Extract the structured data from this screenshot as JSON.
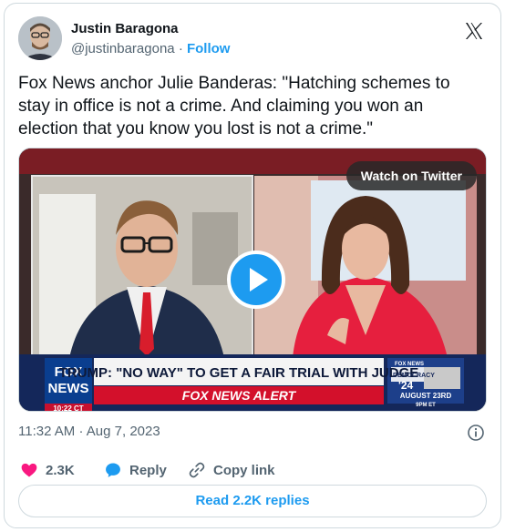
{
  "author": {
    "name": "Justin Baragona",
    "handle": "@justinbaragona",
    "separator": "·",
    "follow_label": "Follow"
  },
  "tweet": {
    "text": "Fox News anchor Julie Banderas: \"Hatching schemes to stay in office is not a crime. And claiming you won an election that you know you lost is not a crime.\"",
    "time": "11:32 AM",
    "date": "Aug 7, 2023",
    "meta_separator": "·"
  },
  "video": {
    "watch_label": "Watch on Twitter",
    "chyron_headline": "TRUMP: \"NO WAY\" TO GET A FAIR TRIAL WITH JUDGE",
    "chyron_alert": "FOX NEWS ALERT",
    "logo_line1": "FOX",
    "logo_line2": "NEWS",
    "clock": "10:22 CT",
    "promo_line1": "FOX NEWS",
    "promo_line2": "DEMOCRACY",
    "promo_line3": "'24",
    "promo_date": "AUGUST 23RD",
    "promo_time": "9PM ET"
  },
  "actions": {
    "likes": "2.3K",
    "reply_label": "Reply",
    "copy_label": "Copy link",
    "read_replies_label": "Read 2.2K replies"
  },
  "colors": {
    "accent": "#1d9bf0",
    "like": "#f91880",
    "muted": "#536471"
  },
  "icons": {
    "brand": "x-logo",
    "info": "info-icon",
    "like": "heart-icon",
    "reply": "reply-bubble-icon",
    "copy": "link-icon",
    "play": "play-icon"
  }
}
